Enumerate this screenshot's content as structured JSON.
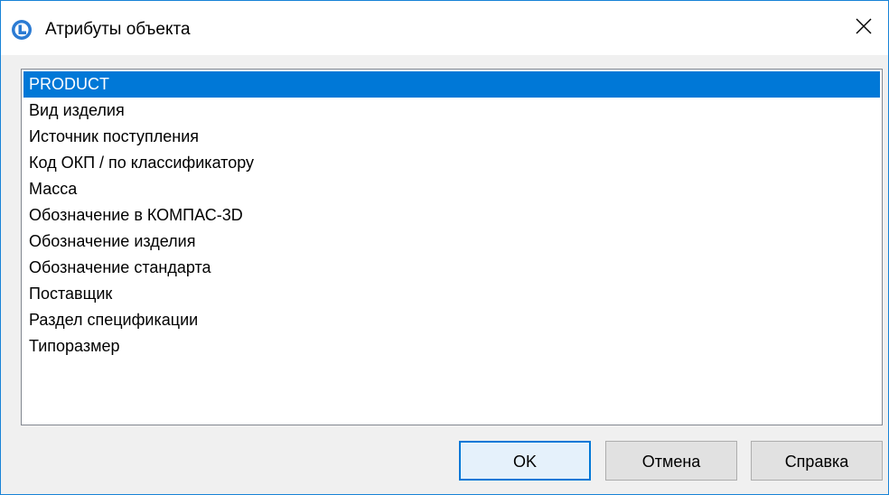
{
  "window": {
    "title": "Атрибуты объекта"
  },
  "list": {
    "selected_index": 0,
    "items": [
      "PRODUCT",
      "Вид изделия",
      "Источник поступления",
      "Код ОКП / по классификатору",
      "Масса",
      "Обозначение в КОМПАС-3D",
      "Обозначение изделия",
      "Обозначение стандарта",
      "Поставщик",
      "Раздел спецификации",
      "Типоразмер"
    ]
  },
  "buttons": {
    "ok": "OK",
    "cancel": "Отмена",
    "help": "Справка"
  },
  "colors": {
    "selection": "#0078d7",
    "window_border": "#1883d7"
  },
  "icons": {
    "app": "kompas-app-icon",
    "close": "close-icon"
  }
}
